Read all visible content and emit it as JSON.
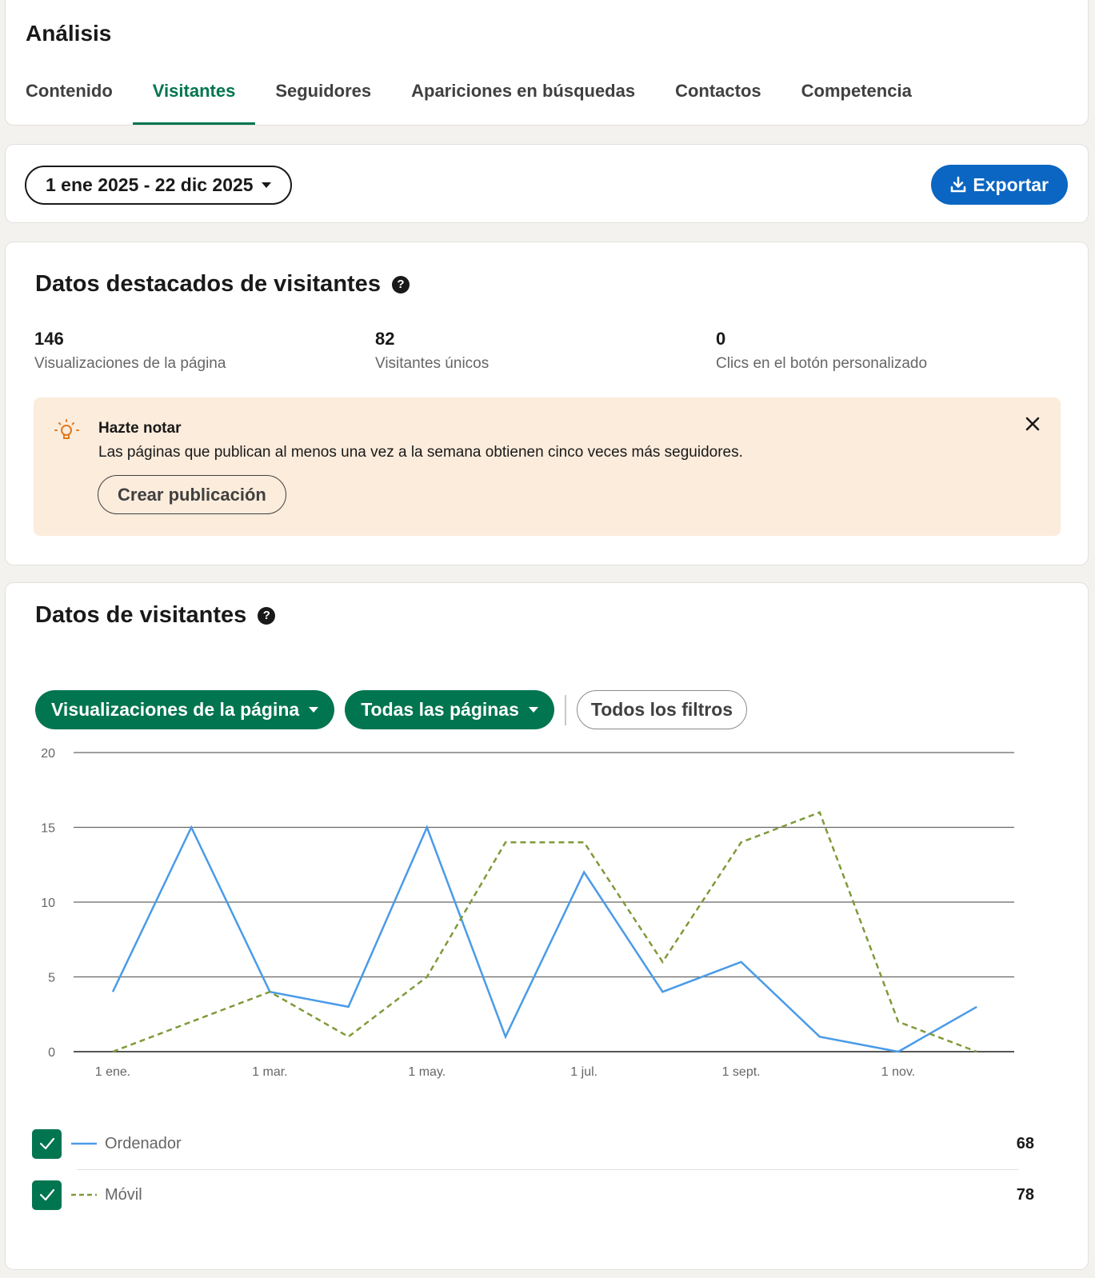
{
  "header": {
    "title": "Análisis",
    "tabs": [
      {
        "label": "Contenido",
        "active": false
      },
      {
        "label": "Visitantes",
        "active": true
      },
      {
        "label": "Seguidores",
        "active": false
      },
      {
        "label": "Apariciones en búsquedas",
        "active": false
      },
      {
        "label": "Contactos",
        "active": false
      },
      {
        "label": "Competencia",
        "active": false
      }
    ]
  },
  "toolbar": {
    "date_range": "1 ene 2025 - 22 dic 2025",
    "export_label": "Exportar"
  },
  "highlights": {
    "title": "Datos destacados de visitantes",
    "metrics": [
      {
        "value": "146",
        "label": "Visualizaciones de la página"
      },
      {
        "value": "82",
        "label": "Visitantes únicos"
      },
      {
        "value": "0",
        "label": "Clics en el botón personalizado"
      }
    ],
    "notice": {
      "title": "Hazte notar",
      "text": "Las páginas que publican al menos una vez a la semana obtienen cinco veces más seguidores.",
      "button": "Crear publicación"
    }
  },
  "visitor_data": {
    "title": "Datos de visitantes",
    "filters": {
      "metric": "Visualizaciones de la página",
      "pages": "Todas las páginas",
      "all_filters": "Todos los filtros"
    },
    "legend": [
      {
        "name": "Ordenador",
        "total": "68",
        "checked": true
      },
      {
        "name": "Móvil",
        "total": "78",
        "checked": true
      }
    ]
  },
  "colors": {
    "accent_green": "#01754f",
    "link_blue": "#0a66c2",
    "series_ordenador": "#4a9be8",
    "series_movil": "#7f9a3a",
    "notice_bg": "#fcecdc"
  },
  "chart_data": {
    "type": "line",
    "x": [
      "1 ene.",
      "",
      "1 mar.",
      "",
      "1 may.",
      "",
      "1 jul.",
      "",
      "1 sept.",
      "",
      "1 nov.",
      ""
    ],
    "series": [
      {
        "name": "Ordenador",
        "style": "solid",
        "values": [
          4,
          15,
          4,
          3,
          15,
          1,
          12,
          4,
          6,
          1,
          0,
          3
        ]
      },
      {
        "name": "Móvil",
        "style": "dashed",
        "values": [
          0,
          2,
          4,
          1,
          5,
          14,
          14,
          6,
          14,
          16,
          2,
          0
        ]
      }
    ],
    "xticks": [
      "1 ene.",
      "1 mar.",
      "1 may.",
      "1 jul.",
      "1 sept.",
      "1 nov."
    ],
    "yticks": [
      0,
      5,
      10,
      15,
      20
    ],
    "ylim": [
      0,
      20
    ],
    "grid": true
  }
}
